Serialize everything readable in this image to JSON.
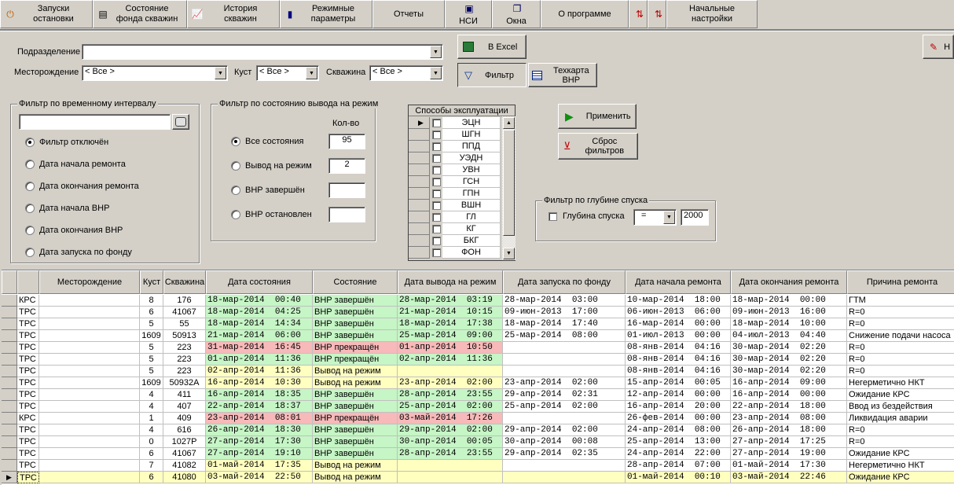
{
  "toolbar": {
    "buttons": [
      {
        "label": "Запуски\nостановки",
        "icon": "power-icon"
      },
      {
        "label": "Состояние\nфонда скважин",
        "icon": "printer-icon"
      },
      {
        "label": "История\nскважин",
        "icon": "chart-icon"
      },
      {
        "label": "Режимные\nпараметры",
        "icon": "bar-chart-icon"
      },
      {
        "label": "Отчеты",
        "icon": ""
      },
      {
        "label": "НСИ",
        "icon": "book-icon"
      },
      {
        "label": "Окна",
        "icon": "windows-icon"
      },
      {
        "label": "О программе",
        "icon": ""
      },
      {
        "label": "",
        "icon": "sort-az-icon"
      },
      {
        "label": "",
        "icon": "sort-za-icon"
      },
      {
        "label": "Начальные\nнастройки",
        "icon": ""
      }
    ]
  },
  "filters": {
    "podrazdelenie_label": "Подразделение",
    "podrazdelenie_value": "",
    "mestorozhdenie_label": "Месторождение",
    "mestorozhdenie_value": "< Все >",
    "kust_label": "Куст",
    "kust_value": "< Все >",
    "skvazhina_label": "Скважина",
    "skvazhina_value": "< Все >"
  },
  "actions": {
    "excel": "В Excel",
    "filter": "Фильтр",
    "techcard": "Техкарта\nВНР",
    "apply": "Применить",
    "reset": "Сброс\nфильтров",
    "right_edge": "Н"
  },
  "time_filter": {
    "title": "Фильтр по  временному интервалу",
    "input_value": "",
    "options": [
      {
        "label": "Фильтр отключён",
        "selected": true
      },
      {
        "label": "Дата начала ремонта",
        "selected": false
      },
      {
        "label": "Дата окончания ремонта",
        "selected": false
      },
      {
        "label": "Дата начала ВНР",
        "selected": false
      },
      {
        "label": "Дата окончания ВНР",
        "selected": false
      },
      {
        "label": "Дата запуска по фонду",
        "selected": false
      }
    ]
  },
  "state_filter": {
    "title": "Фильтр по состоянию вывода на режим",
    "count_header": "Кол-во",
    "options": [
      {
        "label": "Все состояния",
        "selected": true,
        "count": "95"
      },
      {
        "label": "Вывод на режим",
        "selected": false,
        "count": "2"
      },
      {
        "label": "ВНР завершён",
        "selected": false,
        "count": ""
      },
      {
        "label": "ВНР остановлен",
        "selected": false,
        "count": ""
      }
    ]
  },
  "sposoby": {
    "title": "Способы эксплуатации",
    "items": [
      "ЭЦН",
      "ШГН",
      "ППД",
      "УЭДН",
      "УВН",
      "ГСН",
      "ГПН",
      "ВШН",
      "ГЛ",
      "КГ",
      "БКГ",
      "ФОН"
    ]
  },
  "depth_filter": {
    "title": "Фильтр по  глубине спуска",
    "checkbox_label": "Глубина спуска",
    "operator": "=",
    "value": "2000"
  },
  "grid": {
    "columns": [
      "",
      "Месторождение",
      "Куст",
      "Скважина",
      "Дата состояния",
      "Состояние",
      "Дата вывода на режим",
      "Дата запуска по фонду",
      "Дата начала ремонта",
      "Дата окончания ремонта",
      "Причина ремонта"
    ],
    "rows": [
      {
        "code": "КРС",
        "kust": "8",
        "skv": "176",
        "date_state": "18-мар-2014  00:40",
        "state": "ВНР завершён",
        "date_vnr": "28-мар-2014  03:19",
        "date_zap": "28-мар-2014  03:00",
        "date_start": "10-мар-2014  18:00",
        "date_end": "18-мар-2014  00:00",
        "reason": "ГТМ",
        "color": "green"
      },
      {
        "code": "ТРС",
        "kust": "6",
        "skv": "41067",
        "date_state": "18-мар-2014  04:25",
        "state": "ВНР завершён",
        "date_vnr": "21-мар-2014  10:15",
        "date_zap": "09-июн-2013  17:00",
        "date_start": "06-июн-2013  06:00",
        "date_end": "09-июн-2013  16:00",
        "reason": "R=0",
        "color": "green"
      },
      {
        "code": "ТРС",
        "kust": "5",
        "skv": "55",
        "date_state": "18-мар-2014  14:34",
        "state": "ВНР завершён",
        "date_vnr": "18-мар-2014  17:38",
        "date_zap": "18-мар-2014  17:40",
        "date_start": "16-мар-2014  00:00",
        "date_end": "18-мар-2014  10:00",
        "reason": "R=0",
        "color": "green"
      },
      {
        "code": "ТРС",
        "kust": "1609",
        "skv": "50913",
        "date_state": "21-мар-2014  06:00",
        "state": "ВНР завершён",
        "date_vnr": "25-мар-2014  09:00",
        "date_zap": "25-мар-2014  08:00",
        "date_start": "01-июл-2013  00:00",
        "date_end": "04-июл-2013  04:40",
        "reason": "Снижение подачи насоса",
        "color": "green"
      },
      {
        "code": "ТРС",
        "kust": "5",
        "skv": "223",
        "date_state": "31-мар-2014  16:45",
        "state": "ВНР прекращён",
        "date_vnr": "01-апр-2014  10:50",
        "date_zap": "",
        "date_start": "08-янв-2014  04:16",
        "date_end": "30-мар-2014  02:20",
        "reason": "R=0",
        "color": "red"
      },
      {
        "code": "ТРС",
        "kust": "5",
        "skv": "223",
        "date_state": "01-апр-2014  11:36",
        "state": "ВНР прекращён",
        "date_vnr": "02-апр-2014  11:36",
        "date_zap": "",
        "date_start": "08-янв-2014  04:16",
        "date_end": "30-мар-2014  02:20",
        "reason": "R=0",
        "color": "green"
      },
      {
        "code": "ТРС",
        "kust": "5",
        "skv": "223",
        "date_state": "02-апр-2014  11:36",
        "state": "Вывод на режим",
        "date_vnr": "",
        "date_zap": "",
        "date_start": "08-янв-2014  04:16",
        "date_end": "30-мар-2014  02:20",
        "reason": "R=0",
        "color": "yellow"
      },
      {
        "code": "ТРС",
        "kust": "1609",
        "skv": "50932А",
        "date_state": "16-апр-2014  10:30",
        "state": "Вывод на режим",
        "date_vnr": "23-апр-2014  02:00",
        "date_zap": "23-апр-2014  02:00",
        "date_start": "15-апр-2014  00:05",
        "date_end": "16-апр-2014  09:00",
        "reason": "Негерметично НКТ",
        "color": "yellow"
      },
      {
        "code": "ТРС",
        "kust": "4",
        "skv": "411",
        "date_state": "16-апр-2014  18:35",
        "state": "ВНР завершён",
        "date_vnr": "28-апр-2014  23:55",
        "date_zap": "29-апр-2014  02:31",
        "date_start": "12-апр-2014  00:00",
        "date_end": "16-апр-2014  00:00",
        "reason": "Ожидание КРС",
        "color": "green"
      },
      {
        "code": "ТРС",
        "kust": "4",
        "skv": "407",
        "date_state": "22-апр-2014  18:37",
        "state": "ВНР завершён",
        "date_vnr": "25-апр-2014  02:00",
        "date_zap": "25-апр-2014  02:00",
        "date_start": "16-апр-2014  20:00",
        "date_end": "22-апр-2014  18:00",
        "reason": "Ввод из бездействия",
        "color": "green"
      },
      {
        "code": "КРС",
        "kust": "1",
        "skv": "409",
        "date_state": "23-апр-2014  08:01",
        "state": "ВНР прекращён",
        "date_vnr": "03-май-2014  17:26",
        "date_zap": "",
        "date_start": "26-фев-2014  00:00",
        "date_end": "23-апр-2014  08:00",
        "reason": "Ликвидация аварии",
        "color": "red"
      },
      {
        "code": "ТРС",
        "kust": "4",
        "skv": "616",
        "date_state": "26-апр-2014  18:30",
        "state": "ВНР завершён",
        "date_vnr": "29-апр-2014  02:00",
        "date_zap": "29-апр-2014  02:00",
        "date_start": "24-апр-2014  08:00",
        "date_end": "26-апр-2014  18:00",
        "reason": "R=0",
        "color": "green"
      },
      {
        "code": "ТРС",
        "kust": "0",
        "skv": "1027Р",
        "date_state": "27-апр-2014  17:30",
        "state": "ВНР завершён",
        "date_vnr": "30-апр-2014  00:05",
        "date_zap": "30-апр-2014  00:08",
        "date_start": "25-апр-2014  13:00",
        "date_end": "27-апр-2014  17:25",
        "reason": "R=0",
        "color": "green"
      },
      {
        "code": "ТРС",
        "kust": "6",
        "skv": "41067",
        "date_state": "27-апр-2014  19:10",
        "state": "ВНР завершён",
        "date_vnr": "28-апр-2014  23:55",
        "date_zap": "29-апр-2014  02:35",
        "date_start": "24-апр-2014  22:00",
        "date_end": "27-апр-2014  19:00",
        "reason": "Ожидание КРС",
        "color": "green"
      },
      {
        "code": "ТРС",
        "kust": "7",
        "skv": "41082",
        "date_state": "01-май-2014  17:35",
        "state": "Вывод на режим",
        "date_vnr": "",
        "date_zap": "",
        "date_start": "28-апр-2014  07:00",
        "date_end": "01-май-2014  17:30",
        "reason": "Негерметично НКТ",
        "color": "yellow"
      },
      {
        "code": "ТРС",
        "kust": "6",
        "skv": "41080",
        "date_state": "03-май-2014  22:50",
        "state": "Вывод на режим",
        "date_vnr": "",
        "date_zap": "",
        "date_start": "01-май-2014  00:10",
        "date_end": "03-май-2014  22:46",
        "reason": "Ожидание КРС",
        "color": "yellow"
      }
    ]
  }
}
